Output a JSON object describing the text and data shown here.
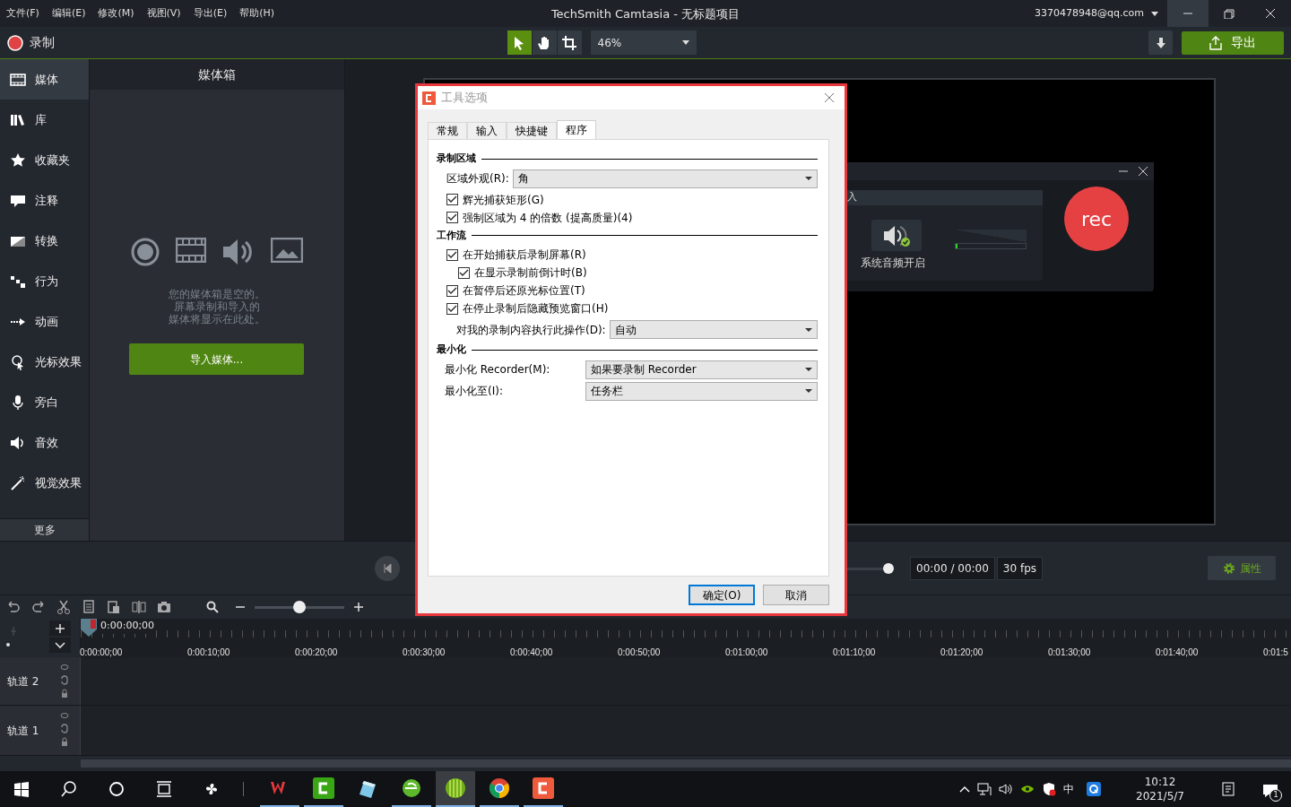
{
  "window": {
    "menu": [
      "文件(F)",
      "编辑(E)",
      "修改(M)",
      "视图(V)",
      "导出(E)",
      "帮助(H)"
    ],
    "title": "TechSmith Camtasia - 无标题项目",
    "account": "3370478948@qq.com"
  },
  "toolbar": {
    "record": "录制",
    "tools": [
      {
        "kind": "pointer",
        "selected": true
      },
      {
        "kind": "hand",
        "selected": false
      },
      {
        "kind": "crop",
        "selected": false
      }
    ],
    "zoom": "46%",
    "export": "导出"
  },
  "sidebar": {
    "items": [
      {
        "label": "媒体",
        "selected": true
      },
      {
        "label": "库",
        "selected": false
      },
      {
        "label": "收藏夹",
        "selected": false
      },
      {
        "label": "注释",
        "selected": false
      },
      {
        "label": "转换",
        "selected": false
      },
      {
        "label": "行为",
        "selected": false
      },
      {
        "label": "动画",
        "selected": false
      },
      {
        "label": "光标效果",
        "selected": false
      },
      {
        "label": "旁白",
        "selected": false
      },
      {
        "label": "音效",
        "selected": false
      },
      {
        "label": "视觉效果",
        "selected": false
      }
    ],
    "more": "更多"
  },
  "media_bin": {
    "title": "媒体箱",
    "message_lines": [
      "您的媒体箱是空的。",
      "屏幕录制和导入的",
      "媒体将显示在此处。"
    ],
    "import_button": "导入媒体..."
  },
  "recorder": {
    "tab_fragment": "入",
    "source": "系统音频开启",
    "source_on": true,
    "meter": {
      "level": 0.03
    },
    "rec": "rec"
  },
  "dialog": {
    "title": "工具选项",
    "tabs": [
      {
        "label": "常规",
        "selected": false
      },
      {
        "label": "输入",
        "selected": false
      },
      {
        "label": "快捷键",
        "selected": false
      },
      {
        "label": "程序",
        "selected": true
      }
    ],
    "sections": [
      {
        "title": "录制区域",
        "rows": [
          {
            "kind": "dropdown",
            "label": "区域外观(R):",
            "value": "角"
          },
          {
            "kind": "checkbox",
            "label": "辉光捕获矩形(G)",
            "checked": true
          },
          {
            "kind": "checkbox",
            "label": "强制区域为 4 的倍数 (提高质量)(4)",
            "checked": true
          }
        ]
      },
      {
        "title": "工作流",
        "rows": [
          {
            "kind": "checkbox",
            "label": "在开始捕获后录制屏幕(R)",
            "checked": true,
            "children": [
              {
                "kind": "checkbox",
                "label": "在显示录制前倒计时(B)",
                "checked": true
              }
            ]
          },
          {
            "kind": "checkbox",
            "label": "在暂停后还原光标位置(T)",
            "checked": true
          },
          {
            "kind": "checkbox",
            "label": "在停止录制后隐藏预览窗口(H)",
            "checked": true
          },
          {
            "kind": "dropdown",
            "label": "对我的录制内容执行此操作(D):",
            "value": "自动"
          }
        ]
      },
      {
        "title": "最小化",
        "rows": [
          {
            "kind": "dropdown",
            "label": "最小化 Recorder(M):",
            "value": "如果要录制 Recorder"
          },
          {
            "kind": "dropdown",
            "label": "最小化至(I):",
            "value": "任务栏"
          }
        ]
      }
    ],
    "buttons": [
      {
        "label": "确定(O)",
        "default": true
      },
      {
        "label": "取消",
        "default": false
      }
    ]
  },
  "playback": {
    "time": "00:00 / 00:00",
    "fps": "30 fps",
    "properties": "属性"
  },
  "timeline": {
    "zoom_slider": {
      "level": 0.5
    },
    "playhead": "0:00:00;00",
    "ticks": [
      "0:00:00;00",
      "0:00:10;00",
      "0:00:20;00",
      "0:00:30;00",
      "0:00:40;00",
      "0:00:50;00",
      "0:01:00;00",
      "0:01:10;00",
      "0:01:20;00",
      "0:01:30;00",
      "0:01:40;00",
      "0:01:5"
    ],
    "tracks": [
      "轨道 2",
      "轨道 1"
    ]
  },
  "taskbar": {
    "apps": [
      {
        "running": true,
        "active": false
      },
      {
        "running": true,
        "active": false
      },
      {
        "running": false,
        "active": false
      },
      {
        "running": true,
        "active": false
      },
      {
        "running": true,
        "active": true
      },
      {
        "running": true,
        "active": false
      },
      {
        "running": true,
        "active": false
      }
    ],
    "ime": "中",
    "time": "10:12",
    "date": "2021/5/7",
    "notifications": "1"
  }
}
